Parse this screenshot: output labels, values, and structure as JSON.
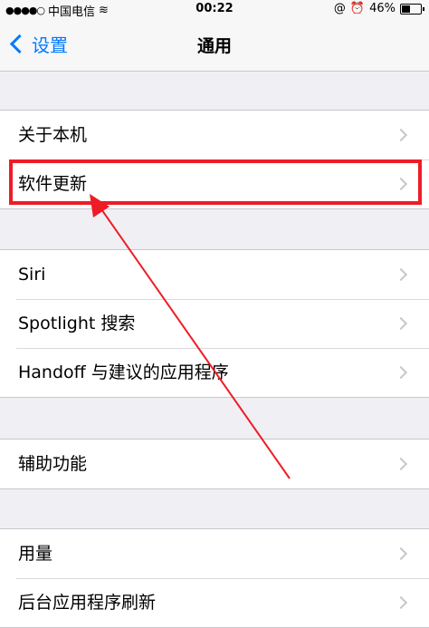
{
  "status_bar": {
    "signal": "●●●●○",
    "carrier": "中国电信",
    "wifi": "≋",
    "time": "00:22",
    "lock_icon": "@",
    "alarm_icon": "⏰",
    "battery_percent": "46%",
    "battery_level": 0.46
  },
  "nav": {
    "back_label": "设置",
    "title": "通用"
  },
  "groups": [
    {
      "items": [
        {
          "label": "关于本机"
        },
        {
          "label": "软件更新"
        }
      ]
    },
    {
      "items": [
        {
          "label": "Siri"
        },
        {
          "label": "Spotlight 搜索"
        },
        {
          "label": "Handoff 与建议的应用程序"
        }
      ]
    },
    {
      "items": [
        {
          "label": "辅助功能"
        }
      ]
    },
    {
      "items": [
        {
          "label": "用量"
        },
        {
          "label": "后台应用程序刷新"
        }
      ]
    }
  ],
  "annotation": {
    "color": "#ee1c25",
    "highlighted_item": "软件更新"
  }
}
